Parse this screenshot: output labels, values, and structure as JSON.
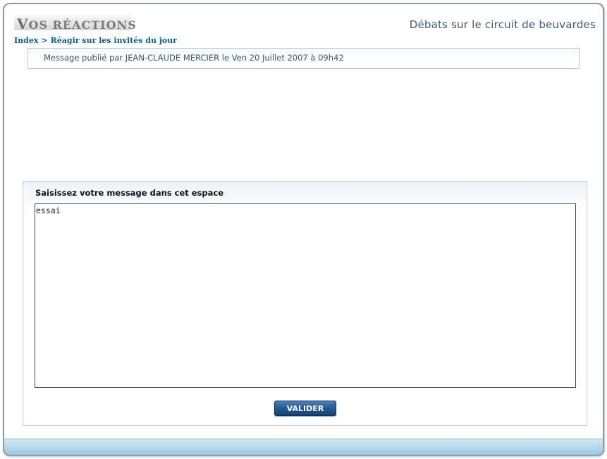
{
  "header": {
    "section_title_initial": "V",
    "section_title_rest": "OS RÉACTIONS",
    "page_title": "Débats sur le circuit de beuvardes",
    "breadcrumb": {
      "home": "Index",
      "separator": ">",
      "current": "Réagir sur les invités du jour"
    }
  },
  "message_info": {
    "text": "Message publié par JEAN-CLAUDE MERCIER le Ven 20 Juillet 2007 à 09h42"
  },
  "form": {
    "label": "Saisissez votre message dans cet espace",
    "message_value": "essai",
    "submit_label": "VALIDER"
  },
  "colors": {
    "accent": "#245a94",
    "breadcrumb": "#0f5e7e",
    "footer": "#b4d6e8"
  }
}
